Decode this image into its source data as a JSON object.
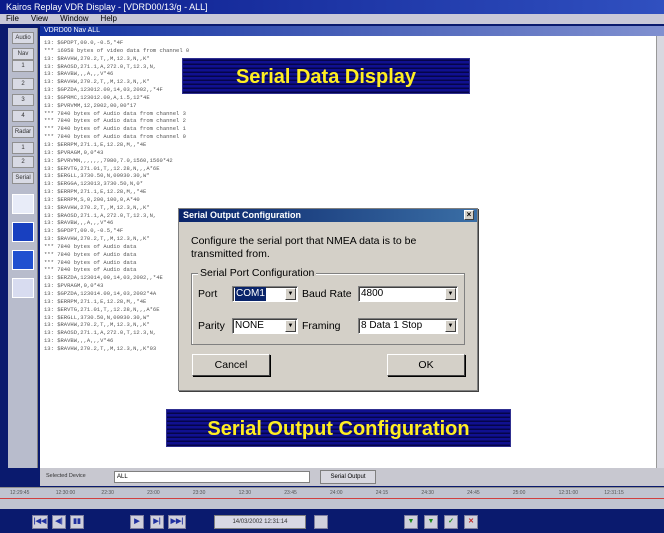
{
  "window": {
    "title": "Kairos Replay VDR Display - [VDRD00/13/g - ALL]",
    "menu": [
      "File",
      "View",
      "Window",
      "Help"
    ],
    "inner_title": "VDRD00 Nav ALL"
  },
  "sidebar": {
    "buttons": [
      "Audio",
      "Nav",
      "1",
      "2",
      "3",
      "4",
      "Radar",
      "1",
      "2",
      "Serial"
    ]
  },
  "data_lines": [
    "13: $GPDPT,00.0,-0.5,*4F",
    "*** 16958 bytes of video data from channel 0",
    "13: $RAVHW,270.2,T,,M,12.3,N,,K*",
    "13: $RAOSD,271.1,A,272.0,T,12.3,N,",
    "13: $RAVBW,,,A,,,V*46",
    "13: $RAVHW,270.2,T,,M,12.3,N,,K*",
    "13: $GPZDA,123012.00,14,03,2002,,*4F",
    "13: $GPRMC,123012.00,A,1.5,12*4E",
    "13: $PVRVMM,12,2002,00,00*17",
    "*** 7840 bytes of Audio data from channel 3",
    "*** 7840 bytes of Audio data from channel 2",
    "*** 7840 bytes of Audio data from channel 1",
    "*** 7840 bytes of Audio data from channel 0",
    "13: $ERRPM,271.1,E,12.28,M,,*4E",
    "13: $PVRAGM,0,0*43",
    "13: $PVRVMN,,,,,,,7980,7.0,1560,1560*42",
    "13: $ERVTG,271.01,T,,12.28,N,,,A*6E",
    "13: $ERGLL,3730.50,N,00930.30,W*",
    "13: $ERGGA,123013,3730.50,N,0*",
    "13: $ERRPM,271.1,E,12.28,M,,*4E",
    "13: $ERRPM,S,0,200,100,0,A*40",
    "13: $RAVHW,270.2,T,,M,12.3,N,,K*",
    "13: $RAOSD,271.1,A,272.0,T,12.3,N,",
    "13: $RAVBW,,,A,,,V*46",
    "13: $GPDPT,00.0,-0.5,*4F",
    "13: $RAVHW,270.2,T,,M,12.3,N,,K*",
    "*** 7840 bytes of Audio data",
    "*** 7840 bytes of Audio data",
    "*** 7840 bytes of Audio data",
    "*** 7840 bytes of Audio data",
    "13: $ERZDA,123014,00,14,03,2002,,*4E",
    "13: $PVRAGM,0,0*43",
    "13: $GPZDA,123014.00,14,03,2002*4A",
    "13: $ERRPM,271.1,E,12.28,M,,*4E",
    "13: $ERVTG,271.01,T,,12.28,N,,,A*6E",
    "13: $ERGLL,3730.50,N,00930.30,W*",
    "13: $RAVHW,270.2,T,,M,12.3,N,,K*",
    "13: $RAOSD,271.1,A,272.0,T,12.3,N,",
    "13: $RAVBW,,,A,,,V*46",
    "13: $RAVHW,270.2,T,,M,12.3,N,,K*03"
  ],
  "banners": {
    "top": "Serial Data Display",
    "bottom": "Serial Output Configuration"
  },
  "dialog": {
    "title": "Serial Output Configuration",
    "close": "×",
    "description": "Configure the serial port that NMEA data is to be transmitted from.",
    "group_label": "Serial Port Configuration",
    "port_label": "Port",
    "port_value": "COM1",
    "baud_label": "Baud Rate",
    "baud_value": "4800",
    "parity_label": "Parity",
    "parity_value": "NONE",
    "framing_label": "Framing",
    "framing_value": "8 Data 1 Stop",
    "cancel_label": "Cancel",
    "ok_label": "OK"
  },
  "bottom": {
    "device_label": "Selected Device",
    "device_value": "ALL",
    "serial_output_label": "Serial Output",
    "timeline_ticks": [
      "12:29:45",
      "12:30:00",
      "22:30",
      "23:00",
      "23:30",
      "12:30",
      "23:45",
      "24:00",
      "24:15",
      "24:30",
      "24:45",
      "25:00",
      "12:31:00",
      "12:31:15"
    ],
    "transport_buttons": [
      "|◀◀",
      "◀|",
      "▮▮",
      "▶",
      "▶|",
      "▶▶|"
    ],
    "time_value": "14/03/2002 12:31:14"
  }
}
